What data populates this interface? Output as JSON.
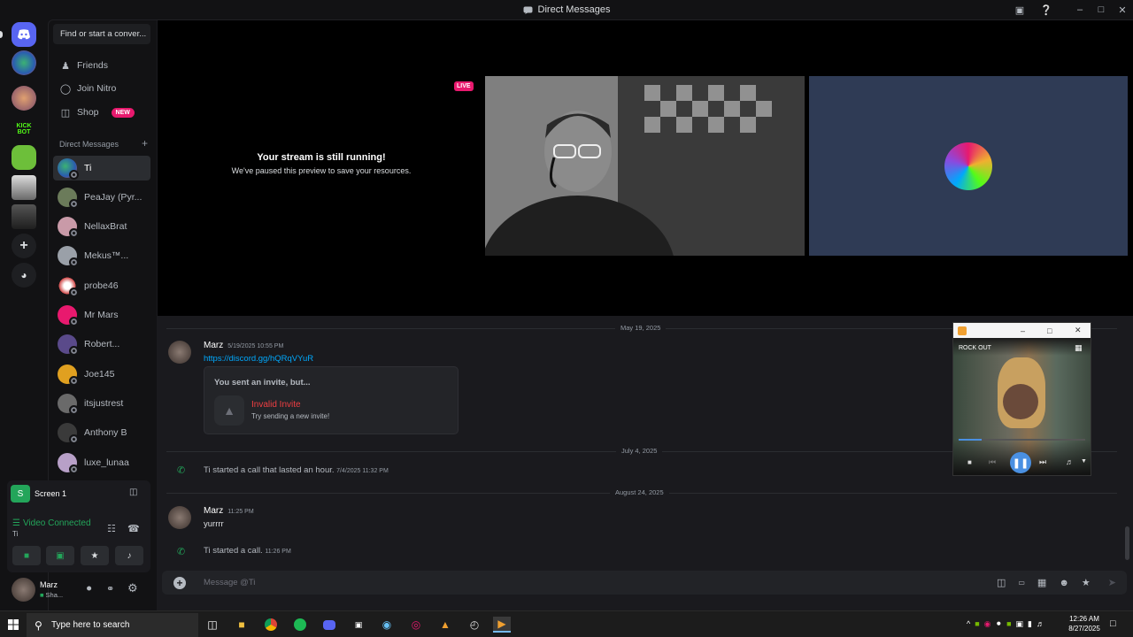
{
  "window": {
    "title": "Direct Messages"
  },
  "sidebar": {
    "search_placeholder": "Find or start a conver...",
    "nav": [
      {
        "label": "Friends",
        "icon": "friends-icon"
      },
      {
        "label": "Join Nitro",
        "icon": "nitro-icon"
      },
      {
        "label": "Shop",
        "icon": "shop-icon",
        "badge": "NEW"
      }
    ],
    "dm_header": "Direct Messages",
    "dm_add": "+",
    "dms": [
      {
        "name": "Ti",
        "selected": true,
        "color": "#5865f2"
      },
      {
        "name": "PeaJay (Pyr...",
        "color": "#6b7b5a"
      },
      {
        "name": "NellaxBrat",
        "color": "#c99aa8"
      },
      {
        "name": "Mekus™...",
        "color": "#9aa0a8"
      },
      {
        "name": "probe46",
        "color": "#d04848"
      },
      {
        "name": "Mr Mars",
        "color": "#e8196e"
      },
      {
        "name": "Robert...",
        "color": "#5a4a8a"
      },
      {
        "name": "Joe145",
        "color": "#e0a020"
      },
      {
        "name": "itsjustrest",
        "color": "#6a6a6a"
      },
      {
        "name": "Anthony B",
        "color": "#3a3a3a"
      },
      {
        "name": "luxe_lunaa",
        "color": "#b8a0c8"
      }
    ],
    "servers": [
      {
        "label": "KICK BOT",
        "color": "#121214",
        "text_color": "#53fc18"
      }
    ]
  },
  "voice": {
    "stream_label": "Screen 1",
    "stream_initial": "S",
    "status": "Video Connected",
    "channel": "Ti"
  },
  "user": {
    "name": "Marz",
    "status": "Sha..."
  },
  "stage": {
    "live_badge": "LIVE",
    "paused_title": "Your stream is still running!",
    "paused_text": "We've paused this preview to save your resources."
  },
  "messages": {
    "dates": [
      "May 19, 2025",
      "July 4, 2025",
      "August 24, 2025"
    ],
    "m1": {
      "author": "Marz",
      "time": "5/19/2025 10:55 PM",
      "link": "https://discord.gg/hQRqVYuR"
    },
    "invite": {
      "heading": "You sent an invite, but...",
      "title": "Invalid Invite",
      "subtitle": "Try sending a new invite!"
    },
    "call1": {
      "text": "Ti started a call that lasted an hour.",
      "time": "7/4/2025 11:32 PM"
    },
    "m2": {
      "author": "Marz",
      "time": "11:25 PM",
      "text": "yurrrr"
    },
    "call2": {
      "text": "Ti started a call.",
      "time": "11:26 PM"
    }
  },
  "composer": {
    "placeholder": "Message @Ti"
  },
  "player": {
    "title": "ROCK OUT",
    "progress": 0.18
  },
  "taskbar": {
    "search": "Type here to search",
    "time": "12:26 AM",
    "date": "8/27/2025"
  },
  "colors": {
    "accent": "#5865f2",
    "live": "#e8196e",
    "link": "#00a8fc",
    "green": "#23a55a",
    "invalid": "#f23f43"
  }
}
